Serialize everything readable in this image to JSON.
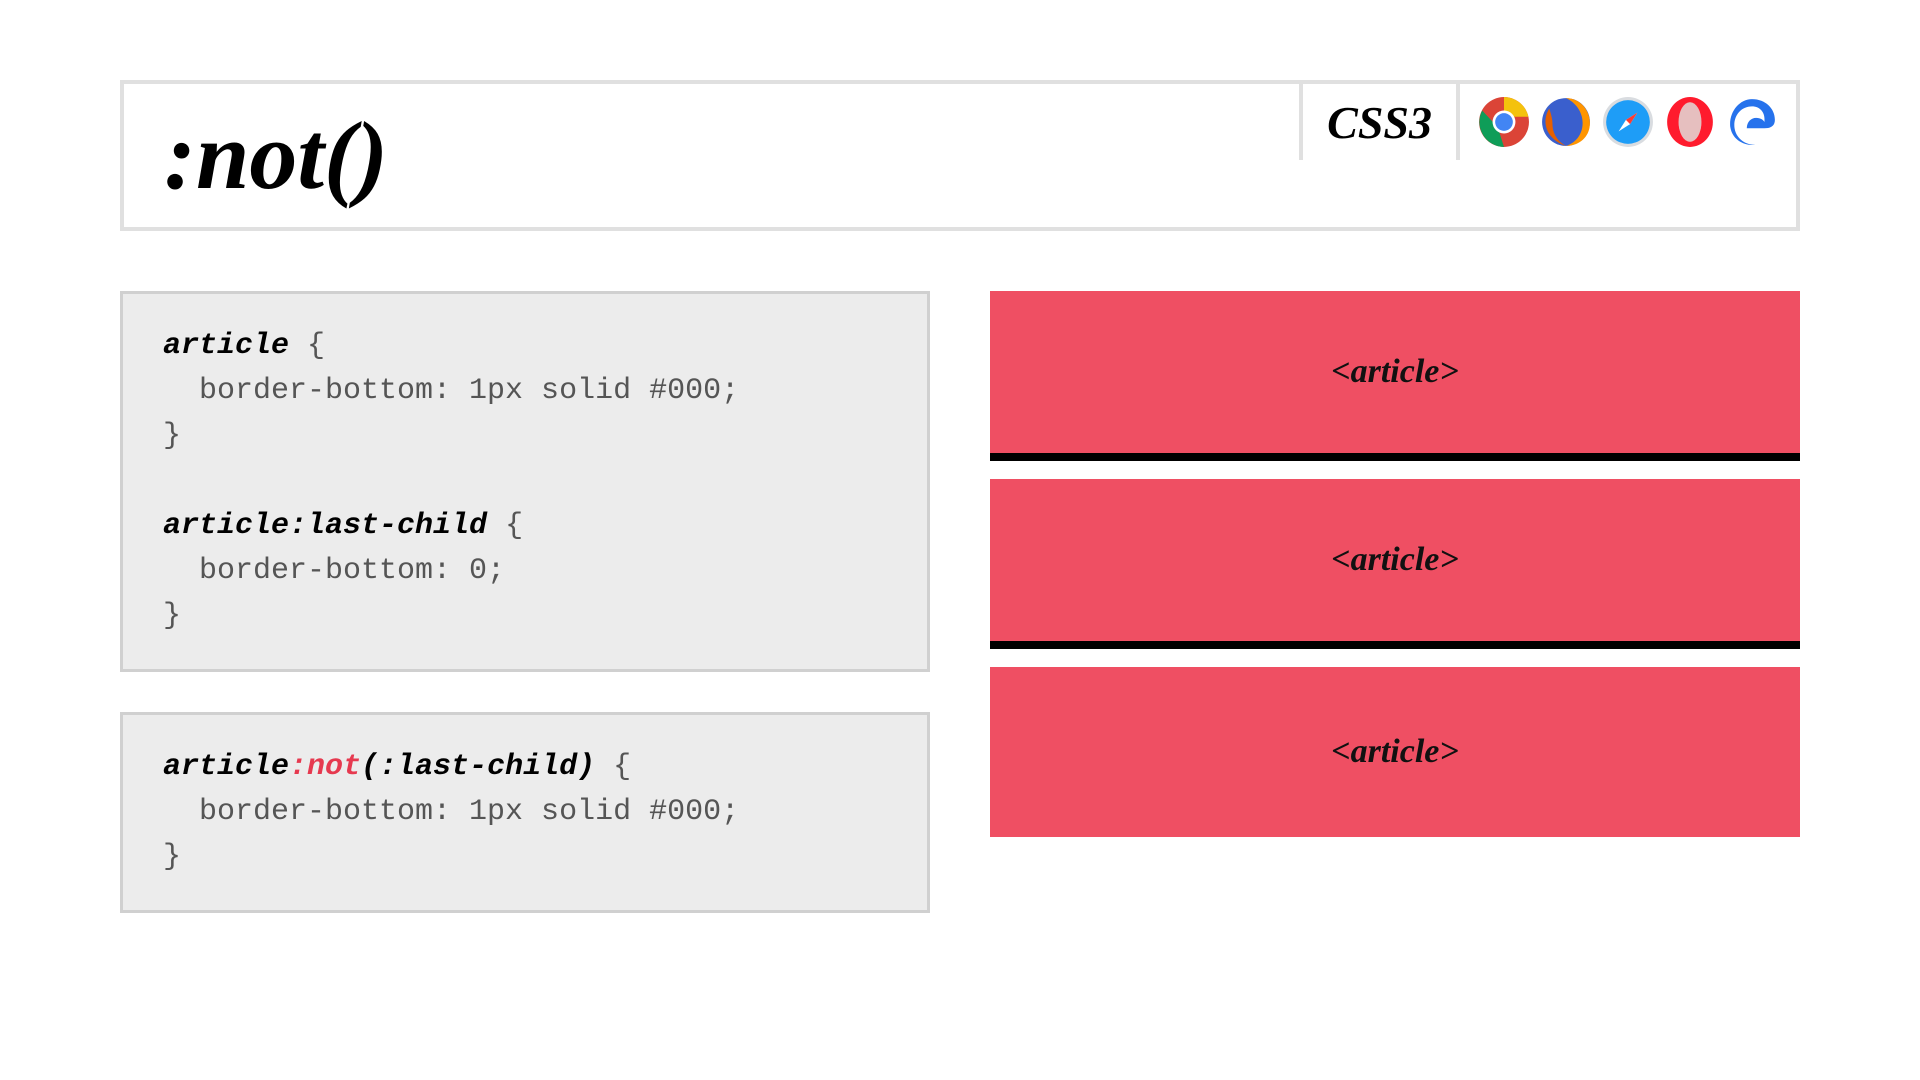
{
  "header": {
    "title": ":not()",
    "spec_label": "CSS3"
  },
  "browsers": [
    "chrome",
    "firefox",
    "safari",
    "opera",
    "edge"
  ],
  "code": {
    "block1": {
      "line1_sel": "article",
      "line1_brace": " {",
      "line2": "  border-bottom: 1px solid #000;",
      "line3": "}",
      "blank": "",
      "line4_sel": "article:last-child",
      "line4_brace": " {",
      "line5": "  border-bottom: 0;",
      "line6": "}"
    },
    "block2": {
      "sel_a": "article",
      "sel_not": ":not",
      "sel_b": "(:last-child)",
      "brace": " {",
      "line2": "  border-bottom: 1px solid #000;",
      "line3": "}"
    }
  },
  "demo": {
    "label": "<article>"
  }
}
